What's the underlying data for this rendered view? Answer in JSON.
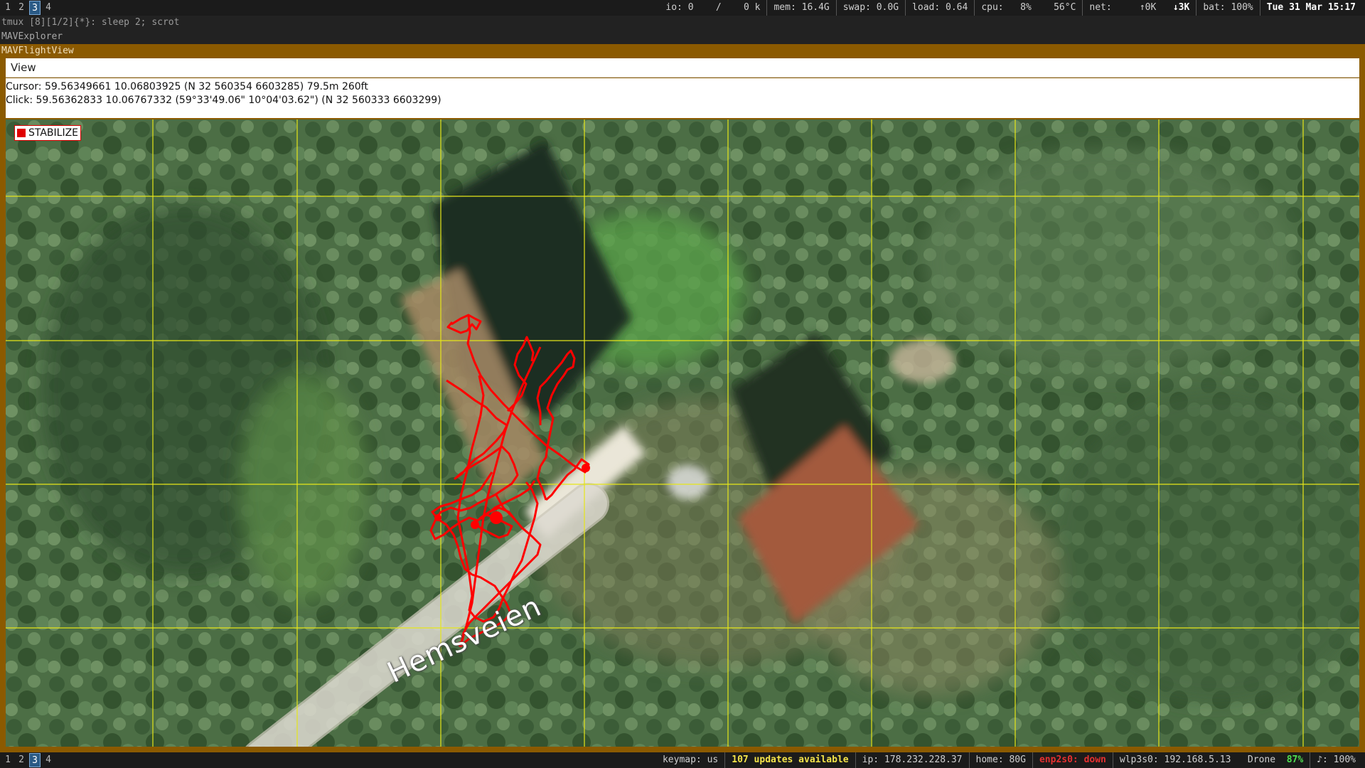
{
  "top_bar": {
    "workspaces": [
      {
        "label": "1",
        "active": false
      },
      {
        "label": "2",
        "active": false
      },
      {
        "label": "3",
        "active": true
      },
      {
        "label": "4",
        "active": false
      }
    ],
    "status": {
      "io": "io: 0",
      "io_sep": "/",
      "io_k": "0 k",
      "mem": "mem: 16.4G",
      "swap": "swap: 0.0G",
      "load": "load: 0.64",
      "cpu": "cpu:",
      "cpu_pct": "8%",
      "temp": "56°C",
      "net": "net:",
      "net_up": "↑0K",
      "net_down": "↓3K",
      "bat": "bat: 100%",
      "datetime": "Tue 31 Mar 15:17"
    }
  },
  "terminal_title": "tmux [8][1/2]{*}:  sleep 2; scrot",
  "explorer_title": "MAVExplorer",
  "flightview_title": "MAVFlightView",
  "menu": {
    "view": "View"
  },
  "info": {
    "cursor": "Cursor: 59.56349661 10.06803925 (N 32 560354 6603285) 79.5m 260ft",
    "click": "Click: 59.56362833 10.06767332 (59°33'49.06\" 10°04'03.62\") (N 32 560333 6603299)"
  },
  "map": {
    "mode_label": "STABILIZE",
    "road_label": "Hemsveien",
    "grid_color": "#e6e619",
    "track_color": "#ff0000"
  },
  "bottom_bar": {
    "workspaces": [
      {
        "label": "1",
        "active": false
      },
      {
        "label": "2",
        "active": false
      },
      {
        "label": "3",
        "active": true
      },
      {
        "label": "4",
        "active": false
      }
    ],
    "status": {
      "keymap": "keymap: us",
      "updates": "107 updates available",
      "ip": "ip: 178.232.228.37",
      "home": "home: 80G",
      "enp": "enp2s0: down",
      "wlp": "wlp3s0: 192.168.5.13",
      "wifi_name": "Drone",
      "wifi_pct": "87%",
      "volume": "♪: 100%"
    }
  }
}
